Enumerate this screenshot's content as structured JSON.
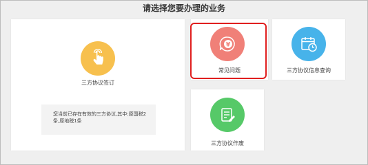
{
  "page": {
    "title": "请选择您要办理的业务"
  },
  "services": {
    "tripartite_sign": {
      "label": "三方协议签订",
      "icon": "hand-pointer-icon",
      "color": "#f7c04e"
    },
    "faq": {
      "label": "常见问题",
      "icon": "money-chat-icon",
      "color": "#f08078"
    },
    "tripartite_query": {
      "label": "三方协议信息查询",
      "icon": "calendar-clock-icon",
      "color": "#47b3ea"
    },
    "tripartite_void": {
      "label": "三方协议作废",
      "icon": "document-pen-icon",
      "color": "#56c968"
    }
  },
  "notice": {
    "text": "您当前已存在有效的三方协议,其中:原国税2条,原地税1条"
  },
  "highlight_color": "#e01e1e"
}
